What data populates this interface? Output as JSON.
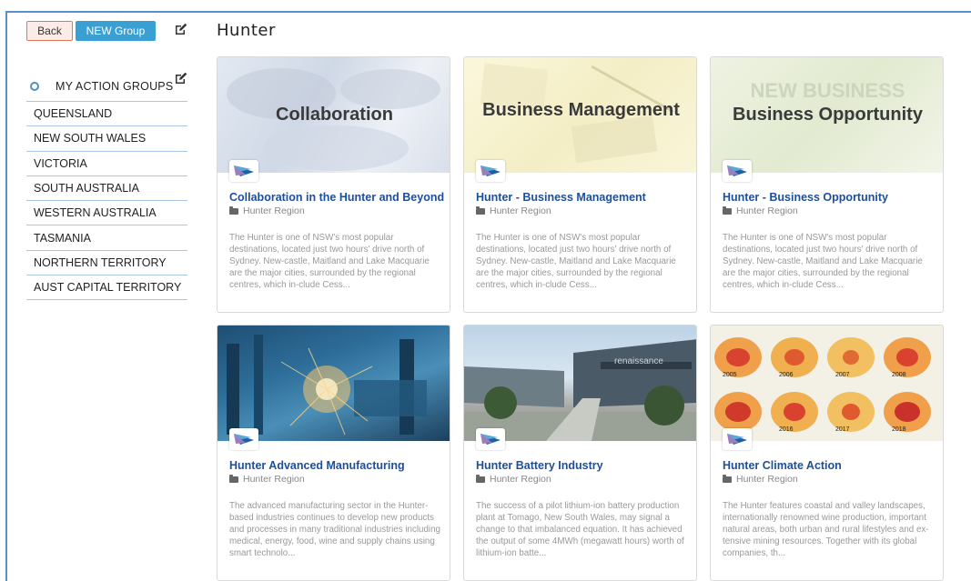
{
  "toolbar": {
    "back_label": "Back",
    "new_group_label": "NEW Group"
  },
  "page": {
    "title": "Hunter"
  },
  "sidebar": {
    "header_label": "MY ACTION GROUPS",
    "items": [
      {
        "label": "QUEENSLAND"
      },
      {
        "label": "NEW SOUTH WALES"
      },
      {
        "label": "VICTORIA"
      },
      {
        "label": "SOUTH AUSTRALIA"
      },
      {
        "label": "WESTERN AUSTRALIA"
      },
      {
        "label": "TASMANIA"
      },
      {
        "label": "NORTHERN TERRITORY"
      },
      {
        "label": "AUST CAPITAL TERRITORY"
      }
    ]
  },
  "cards": [
    {
      "image_title": "Collaboration",
      "title": "Collaboration in the Hunter and Beyond",
      "region": "Hunter Region",
      "description": "The Hunter is one of NSW's most popular destinations, located just two hours' drive north of Sydney. New-castle, Maitland and Lake Macquarie are the major cities, surrounded by the regional centres, which in-clude Cess..."
    },
    {
      "image_title": "Business Management",
      "title": "Hunter - Business Management",
      "region": "Hunter Region",
      "description": "The Hunter is one of NSW's most popular destinations, located just two hours' drive north of Sydney. New-castle, Maitland and Lake Macquarie are the major cities, surrounded by the regional centres, which in-clude Cess..."
    },
    {
      "image_title": "Business Opportunity",
      "image_bg_title": "NEW BUSINESS",
      "title": "Hunter - Business Opportunity",
      "region": "Hunter Region",
      "description": "The Hunter is one of NSW's most popular destinations, located just two hours' drive north of Sydney. New-castle, Maitland and Lake Macquarie are the major cities, surrounded by the regional centres, which in-clude Cess..."
    },
    {
      "title": "Hunter Advanced Manufacturing",
      "region": "Hunter Region",
      "description": "The advanced manufacturing sector in the Hunter-based industries continues to develop new products and processes in many traditional industries including medical, energy, food, wine and supply chains using smart technolo..."
    },
    {
      "image_sign": "renaissance",
      "title": "Hunter Battery Industry",
      "region": "Hunter Region",
      "description": "The success of a pilot lithium-ion battery production plant at Tomago, New South Wales, may signal a change to that imbalanced equation. It has achieved the output of some 4MWh (megawatt hours) worth of lithium-ion batte..."
    },
    {
      "map_years": [
        "2005",
        "2006",
        "2007",
        "2008",
        "2016",
        "2017",
        "2018"
      ],
      "title": "Hunter Climate Action",
      "region": "Hunter Region",
      "description": "The Hunter features coastal and valley landscapes, internationally renowned wine production, important natural areas, both urban and rural lifestyles and ex-tensive mining resources. Together with its global companies, th..."
    }
  ],
  "colors": {
    "accent": "#3aa0d3",
    "card_title": "#1d4f9c",
    "back_border": "#e0765f",
    "frame": "#5b8fc9"
  }
}
